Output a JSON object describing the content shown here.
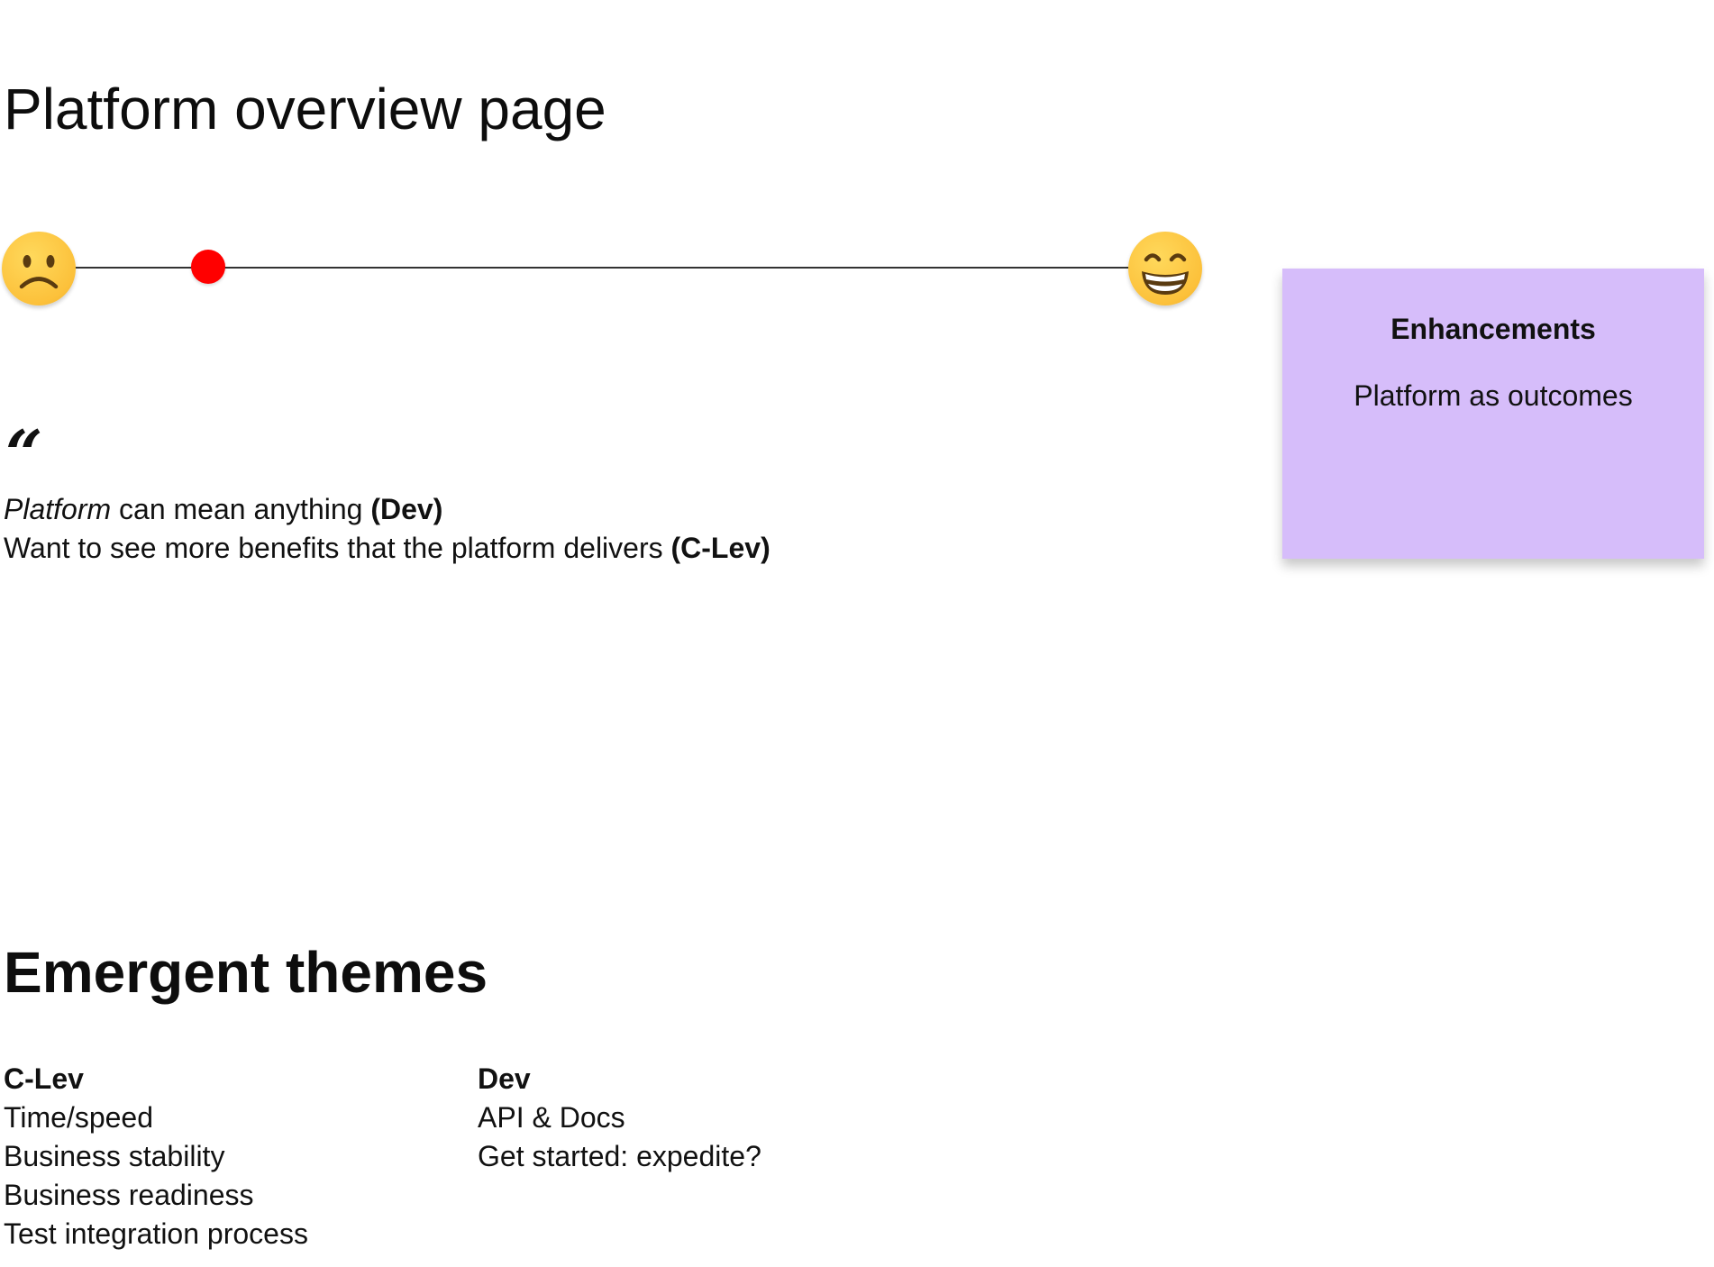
{
  "title": "Platform overview page",
  "sentiment": {
    "low_icon": "sad-face-emoji",
    "high_icon": "grinning-face-emoji",
    "marker_color": "#ff0000",
    "value": 0.15
  },
  "sticky": {
    "title": "Enhancements",
    "body": "Platform as outcomes",
    "color": "#d6bdfa"
  },
  "quotes": {
    "mark": "“",
    "q1": {
      "em": "Platform",
      "text": " can mean anything ",
      "source": "(Dev)"
    },
    "q2": {
      "text": "Want to see more benefits that the platform delivers ",
      "source": "(C-Lev)"
    }
  },
  "themes": {
    "title": "Emergent themes",
    "clev": {
      "header": "C-Lev",
      "items": [
        "Time/speed",
        "Business stability",
        "Business readiness",
        "Test integration process"
      ]
    },
    "dev": {
      "header": "Dev",
      "items": [
        "API & Docs",
        "Get started: expedite?"
      ]
    }
  }
}
